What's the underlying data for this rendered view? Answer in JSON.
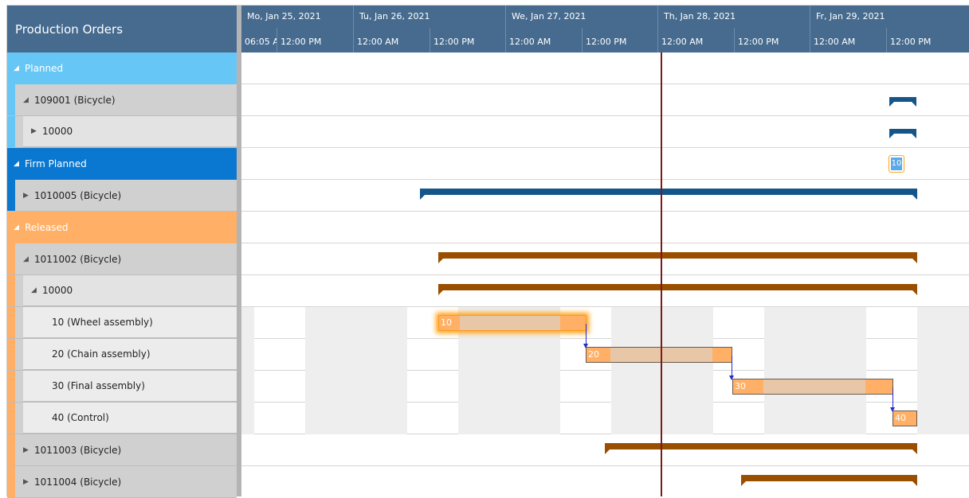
{
  "panel": {
    "title": "Production Orders"
  },
  "rows": [
    {
      "label": "Planned",
      "expand": "◢"
    },
    {
      "label": "109001 (Bicycle)",
      "expand": "◢"
    },
    {
      "label": "10000",
      "expand": "▶"
    },
    {
      "label": "Firm Planned",
      "expand": "◢"
    },
    {
      "label": "1010005 (Bicycle)",
      "expand": "▶"
    },
    {
      "label": "Released",
      "expand": "◢"
    },
    {
      "label": "1011002 (Bicycle)",
      "expand": "◢"
    },
    {
      "label": "10000",
      "expand": "◢"
    },
    {
      "label": "10 (Wheel assembly)",
      "expand": ""
    },
    {
      "label": "20 (Chain assembly)",
      "expand": ""
    },
    {
      "label": "30 (Final assembly)",
      "expand": ""
    },
    {
      "label": "40 (Control)",
      "expand": ""
    },
    {
      "label": "1011003 (Bicycle)",
      "expand": "▶"
    },
    {
      "label": "1011004 (Bicycle)",
      "expand": "▶"
    }
  ],
  "timeline": {
    "days": [
      "Mo, Jan 25, 2021",
      "Tu, Jan 26, 2021",
      "We, Jan 27, 2021",
      "Th, Jan 28, 2021",
      "Fr, Jan 29, 2021"
    ],
    "ticks": [
      "06:05 A",
      "12:00 PM",
      "12:00 AM",
      "12:00 PM",
      "12:00 AM",
      "12:00 PM",
      "12:00 AM",
      "12:00 PM",
      "12:00 AM",
      "12:00 PM"
    ]
  },
  "operations": {
    "op10": "10",
    "op20": "20",
    "op30": "30",
    "op40": "40",
    "firm_chip": "10"
  },
  "colors": {
    "planned": "#66c7f7",
    "firm_planned": "#0a78d0",
    "released": "#ffb066",
    "header": "#466b8f",
    "now_line": "#7a1a1a"
  }
}
